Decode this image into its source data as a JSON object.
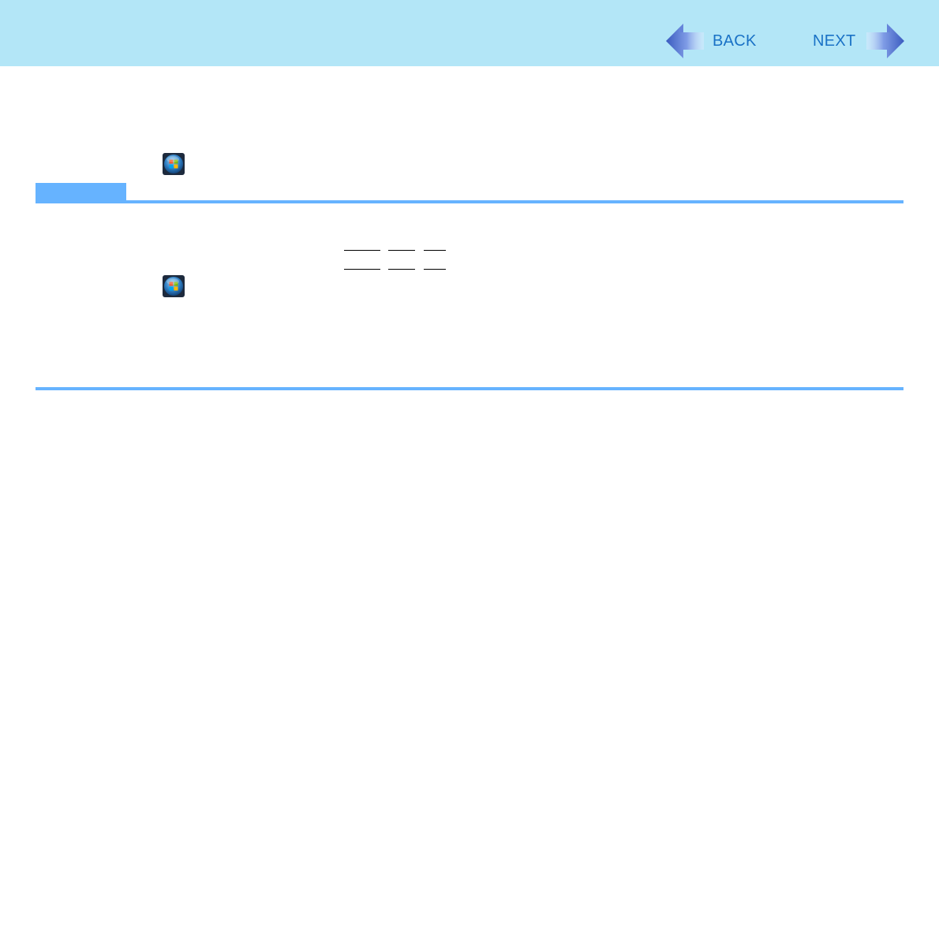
{
  "navigation": {
    "back_label": "BACK",
    "next_label": "NEXT"
  },
  "colors": {
    "header_background": "#b3e6f7",
    "nav_text": "#1a72c6",
    "note_accent": "#66b3ff",
    "arrow_dark": "#3a5bbf",
    "arrow_light": "#d8e4ff"
  },
  "icons": {
    "back": "back-arrow-icon",
    "next": "next-arrow-icon",
    "start": "windows-start-button-icon"
  }
}
